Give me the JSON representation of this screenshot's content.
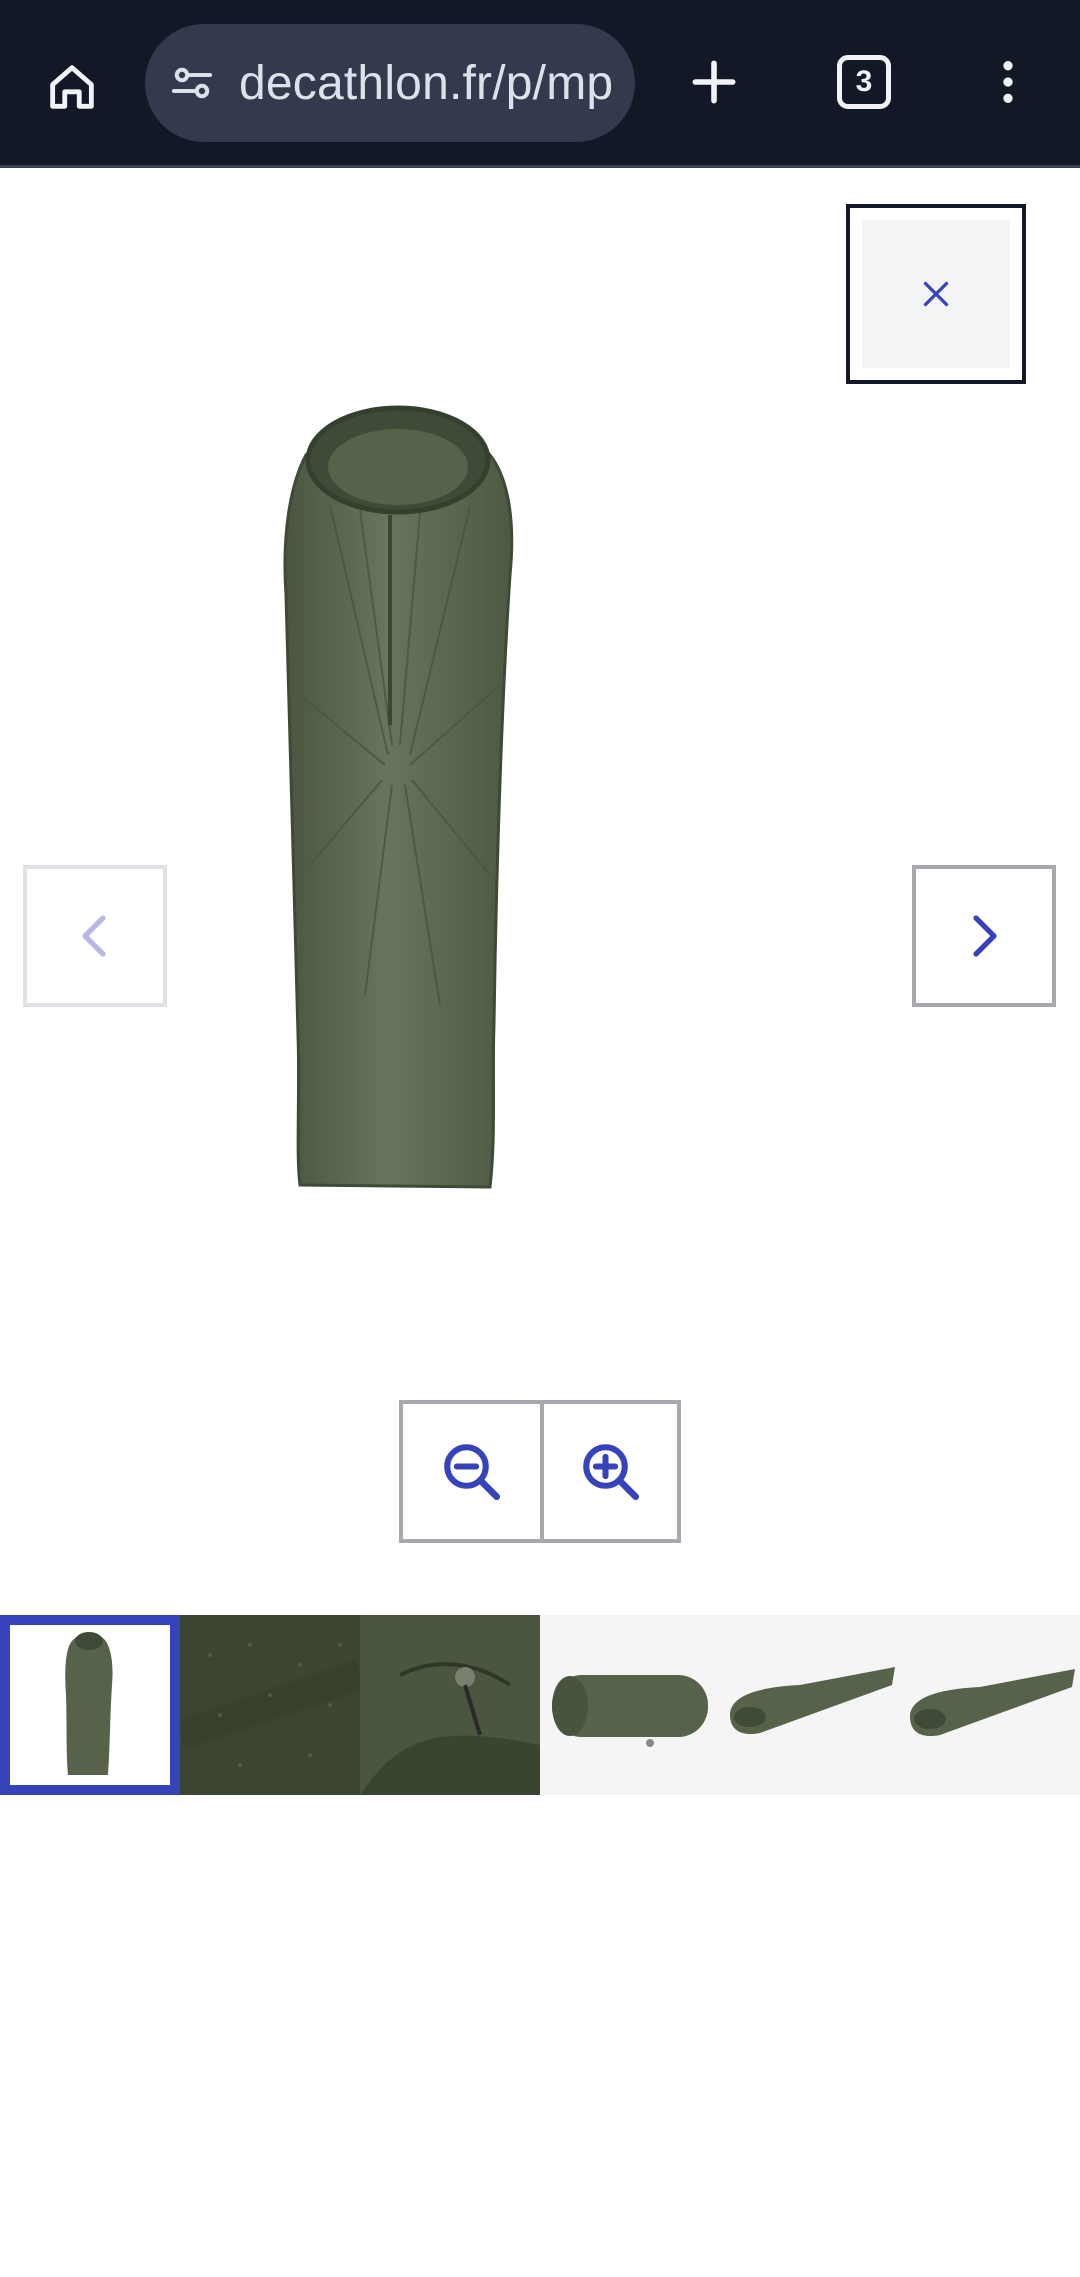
{
  "browser": {
    "url": "decathlon.fr/p/mp",
    "tab_count": "3",
    "icons": {
      "home": "home-icon",
      "site_info": "tune-icon",
      "new_tab": "plus-icon",
      "menu": "more-vert-icon"
    },
    "colors": {
      "bar_bg": "#121826",
      "pill_bg": "#333a4d",
      "text": "#dde1ea"
    }
  },
  "viewer": {
    "close_icon": "close-icon",
    "prev_icon": "chevron-left-icon",
    "next_icon": "chevron-right-icon",
    "zoom_out_icon": "zoom-out-icon",
    "zoom_in_icon": "zoom-in-icon",
    "accent_color": "#3643ba",
    "main_image": "olive-green-sleeping-bag-upright"
  },
  "thumbnails": [
    {
      "subject": "sleeping-bag-upright",
      "selected": true
    },
    {
      "subject": "fabric-closeup",
      "selected": false
    },
    {
      "subject": "drawstring-hood-detail",
      "selected": false
    },
    {
      "subject": "stuff-sack",
      "selected": false
    },
    {
      "subject": "sleeping-bag-side-view",
      "selected": false
    },
    {
      "subject": "sleeping-bag-side-view-2",
      "selected": false
    }
  ]
}
